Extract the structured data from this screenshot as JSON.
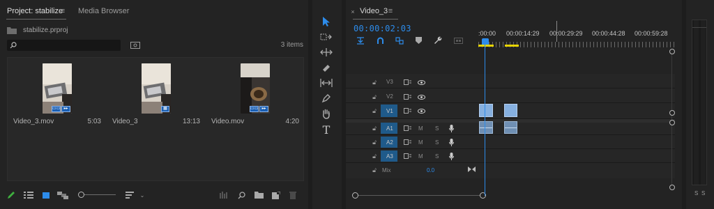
{
  "project": {
    "tab_active": "Project: stabilize",
    "tab_menu_icon": "hamburger-icon",
    "tab_media_browser": "Media Browser",
    "file_name": "stabilize.prproj",
    "search_value": "",
    "item_count": "3 items",
    "clips": [
      {
        "name": "Video_3.mov",
        "duration": "5:03",
        "type": "video+audio"
      },
      {
        "name": "Video_3",
        "duration": "13:13",
        "type": "sequence"
      },
      {
        "name": "Video.mov",
        "duration": "4:20",
        "type": "video+audio"
      }
    ],
    "zoom_level": 0.08
  },
  "timeline": {
    "sequence_name": "Video_3",
    "timecode": "00:00:02:03",
    "ruler_labels": [
      ":00:00",
      "00:00:14:29",
      "00:00:29:29",
      "00:00:44:28",
      "00:00:59:28"
    ],
    "video_tracks": [
      "V3",
      "V2",
      "V1"
    ],
    "audio_tracks": [
      "A1",
      "A2",
      "A3"
    ],
    "mix_label": "Mix",
    "mix_value": "0.0",
    "mute_label": "M",
    "solo_label": "S"
  },
  "meter": {
    "solo_left": "S",
    "solo_right": "S"
  },
  "colors": {
    "accent_blue": "#2d8ceb",
    "track_highlight": "#1f5a8a",
    "clip_blue": "#86b0e0",
    "ruler_yellow": "#e6d300"
  }
}
